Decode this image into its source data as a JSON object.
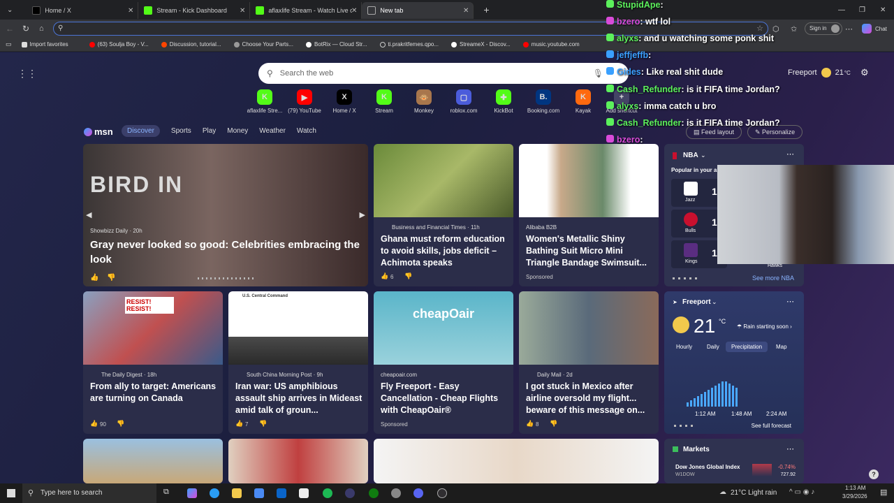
{
  "tabs": [
    {
      "label": "Home / X",
      "active": false
    },
    {
      "label": "Stream - Kick Dashboard",
      "active": false
    },
    {
      "label": "aflaxlife Stream - Watch Live on Ki",
      "active": false
    },
    {
      "label": "New tab",
      "active": true
    }
  ],
  "browser": {
    "signin": "Sign in",
    "chat": "Chat"
  },
  "bookmarks": [
    "Import favorites",
    "(63) Soulja Boy - V...",
    "Discussion, tutorial...",
    "Choose Your Parts...",
    "BotRix — Cloud Str...",
    "ti.prakritfemes.qpo...",
    "StreameX - Discov...",
    "music.youtube.com"
  ],
  "msn": {
    "search_placeholder": "Search the web",
    "location": "Freeport",
    "temp": "21",
    "temp_unit": "°C",
    "logo": "msn",
    "nav": [
      "Discover",
      "Sports",
      "Play",
      "Money",
      "Weather",
      "Watch"
    ],
    "feed_layout": "Feed layout",
    "personalize": "Personalize",
    "shortcuts": [
      {
        "label": "aflaxlife Stre...",
        "icon": "K",
        "color": "#53fc18"
      },
      {
        "label": "(79) YouTube",
        "icon": "▶",
        "color": "#ff0000"
      },
      {
        "label": "Home / X",
        "icon": "X",
        "color": "#000000"
      },
      {
        "label": "Stream",
        "icon": "K",
        "color": "#53fc18"
      },
      {
        "label": "Monkey",
        "icon": "🐵",
        "color": "#a8764c"
      },
      {
        "label": "roblox.com",
        "icon": "▢",
        "color": "#4b5cdb"
      },
      {
        "label": "KickBot",
        "icon": "✚",
        "color": "#53fc18"
      },
      {
        "label": "Booking.com",
        "icon": "B.",
        "color": "#003580"
      },
      {
        "label": "Kayak",
        "icon": "K",
        "color": "#ff690f"
      },
      {
        "label": "Add shortcut",
        "icon": "+",
        "color": "#444466"
      }
    ]
  },
  "cards": [
    {
      "source": "Showbizz Daily · 20h",
      "title": "Gray never looked so good: Celebrities embracing the look",
      "meta": "",
      "img_color": "#4a3b3a"
    },
    {
      "source": "Business and Financial Times · 11h",
      "title": "Ghana must reform education to avoid skills, jobs deficit – Achimota speaks",
      "meta": "6",
      "img_color": "#6b8a3a"
    },
    {
      "source": "Alibaba B2B",
      "title": "Women's Metallic Shiny Bathing Suit Micro Mini Triangle Bandage Swimsuit...",
      "meta": "Sponsored",
      "img_color": "#c8a98a"
    },
    {
      "source": "The Daily Digest · 18h",
      "title": "From ally to target: Americans are turning on Canada",
      "meta": "90",
      "img_color": "#8a6a5a"
    },
    {
      "source": "South China Morning Post · 9h",
      "title": "Iran war: US amphibious assault ship arrives in Mideast amid talk of groun...",
      "meta": "7",
      "img_color": "#3a4050"
    },
    {
      "source": "cheapoair.com",
      "title": "Fly Freeport - Easy Cancellation - Cheap Flights with CheapOair®",
      "meta": "Sponsored",
      "img_color": "#5ab5c9"
    },
    {
      "source": "Daily Mail · 2d",
      "title": "I got stuck in Mexico after airline oversold my flight... beware of this message on...",
      "meta": "8",
      "img_color": "#8a7a5a"
    }
  ],
  "cheapoair_logo": "cheapOair",
  "overlay_texts": {
    "raw_story_sign": "BIRD IN",
    "protest_sign": "RESIST! RESIST!",
    "central_command": "U.S. Central Command"
  },
  "nba": {
    "title": "NBA",
    "popular": "Popular in your ar...",
    "teams": [
      {
        "name": "Jazz",
        "score": "10"
      },
      {
        "name": "Bulls",
        "score": "12"
      },
      {
        "name": "Kings",
        "score": "11"
      }
    ],
    "opponent": "Hawks",
    "see_more": "See more NBA"
  },
  "weather": {
    "location": "Freeport",
    "temp": "21",
    "unit": "°C",
    "alert": "Rain starting soon",
    "tabs": [
      "Hourly",
      "Daily",
      "Precipitation",
      "Map"
    ],
    "times": [
      "1:12 AM",
      "1:48 AM",
      "2:24 AM"
    ],
    "see_full": "See full forecast",
    "precip_levels": [
      0.1,
      0.15,
      0.2,
      0.25,
      0.3,
      0.35,
      0.4,
      0.45,
      0.5,
      0.55,
      0.6,
      0.6,
      0.55,
      0.5,
      0.45
    ]
  },
  "markets": {
    "title": "Markets",
    "index": "Dow Jones Global Index",
    "symbol": "W1DOW",
    "change": "-0.74%",
    "value": "727.92"
  },
  "chat": [
    {
      "user": "StupidApe",
      "msg": "",
      "color": "#5cf05c"
    },
    {
      "user": "bzero",
      "msg": "wtf lol",
      "color": "#d94bd9"
    },
    {
      "user": "alyxs",
      "msg": "and u watching some ponk shit",
      "color": "#5cf05c"
    },
    {
      "user": "jeffjeffb",
      "msg": "",
      "color": "#3aa0ff"
    },
    {
      "user": "Gides",
      "msg": "Like real shit dude",
      "color": "#3aa0ff"
    },
    {
      "user": "Cash_Refunder",
      "msg": "is it FIFA time Jordan?",
      "color": "#5cf05c"
    },
    {
      "user": "alyxs",
      "msg": "imma catch u bro",
      "color": "#5cf05c"
    },
    {
      "user": "Cash_Refunder",
      "msg": "is it FIFA time Jordan?",
      "color": "#5cf05c"
    },
    {
      "user": "bzero",
      "msg": "",
      "color": "#d94bd9"
    }
  ],
  "taskbar": {
    "search": "Type here to search",
    "weather": "21°C  Light rain",
    "time": "1:13 AM",
    "date": "3/29/2026"
  }
}
